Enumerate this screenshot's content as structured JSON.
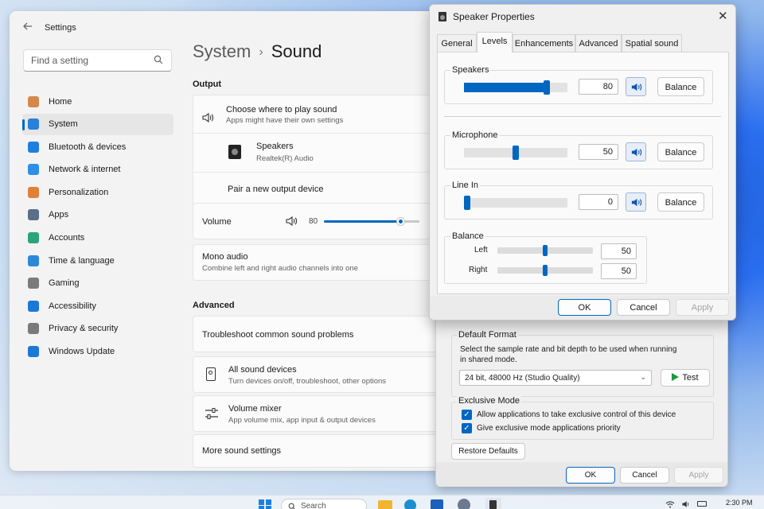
{
  "settings": {
    "title": "Settings",
    "search_placeholder": "Find a setting",
    "nav": [
      {
        "label": "Home",
        "icon": "home-icon",
        "color": "#d6884a"
      },
      {
        "label": "System",
        "icon": "monitor-icon",
        "color": "#2a7fd8",
        "active": true
      },
      {
        "label": "Bluetooth & devices",
        "icon": "bluetooth-icon",
        "color": "#1f7fe0"
      },
      {
        "label": "Network & internet",
        "icon": "wifi-icon",
        "color": "#2d8fe6"
      },
      {
        "label": "Personalization",
        "icon": "brush-icon",
        "color": "#e0813a"
      },
      {
        "label": "Apps",
        "icon": "apps-icon",
        "color": "#5b6f8c"
      },
      {
        "label": "Accounts",
        "icon": "person-icon",
        "color": "#2aa57a"
      },
      {
        "label": "Time & language",
        "icon": "globe-clock-icon",
        "color": "#2a8ad8"
      },
      {
        "label": "Gaming",
        "icon": "gamepad-icon",
        "color": "#7b7b7b"
      },
      {
        "label": "Accessibility",
        "icon": "accessibility-icon",
        "color": "#1b78d6"
      },
      {
        "label": "Privacy & security",
        "icon": "shield-icon",
        "color": "#7a7a7a"
      },
      {
        "label": "Windows Update",
        "icon": "update-icon",
        "color": "#1b78d6"
      }
    ],
    "breadcrumb": {
      "parent": "System",
      "current": "Sound"
    },
    "output": {
      "heading": "Output",
      "choose_title": "Choose where to play sound",
      "choose_sub": "Apps might have their own settings",
      "device_name": "Speakers",
      "device_sub": "Realtek(R) Audio",
      "pair": "Pair a new output device",
      "volume_label": "Volume",
      "volume_value": "80",
      "volume_fraction": 0.8,
      "mono_title": "Mono audio",
      "mono_sub": "Combine left and right audio channels into one"
    },
    "advanced": {
      "heading": "Advanced",
      "troubleshoot": "Troubleshoot common sound problems",
      "all_devices_title": "All sound devices",
      "all_devices_sub": "Turn devices on/off, troubleshoot, other options",
      "mixer_title": "Volume mixer",
      "mixer_sub": "App volume mix, app input & output devices",
      "more": "More sound settings"
    }
  },
  "props_back": {
    "default_format_title": "Default Format",
    "default_format_desc_1": "Select the sample rate and bit depth to be used when running",
    "default_format_desc_2": "in shared mode.",
    "format_selected": "24 bit, 48000 Hz (Studio Quality)",
    "test": "Test",
    "exclusive_title": "Exclusive Mode",
    "exclusive_opt1": "Allow applications to take exclusive control of this device",
    "exclusive_opt2": "Give exclusive mode applications priority",
    "restore": "Restore Defaults",
    "ok": "OK",
    "cancel": "Cancel",
    "apply": "Apply"
  },
  "props": {
    "title": "Speaker Properties",
    "tabs": [
      "General",
      "Levels",
      "Enhancements",
      "Advanced",
      "Spatial sound"
    ],
    "active_tab": "Levels",
    "speakers": {
      "label": "Speakers",
      "value": "80",
      "fraction": 0.8,
      "balance": "Balance"
    },
    "microphone": {
      "label": "Microphone",
      "value": "50",
      "fraction": 0.5,
      "balance": "Balance"
    },
    "line_in": {
      "label": "Line In",
      "value": "0",
      "fraction": 0.0,
      "balance": "Balance"
    },
    "balance": {
      "label": "Balance",
      "left_label": "Left",
      "left_value": "50",
      "right_label": "Right",
      "right_value": "50"
    },
    "ok": "OK",
    "cancel": "Cancel",
    "apply": "Apply"
  },
  "taskbar": {
    "search": "Search",
    "time": "2:30 PM"
  },
  "colors": {
    "accent": "#0067c0",
    "slider_fill": "#0067c0"
  }
}
